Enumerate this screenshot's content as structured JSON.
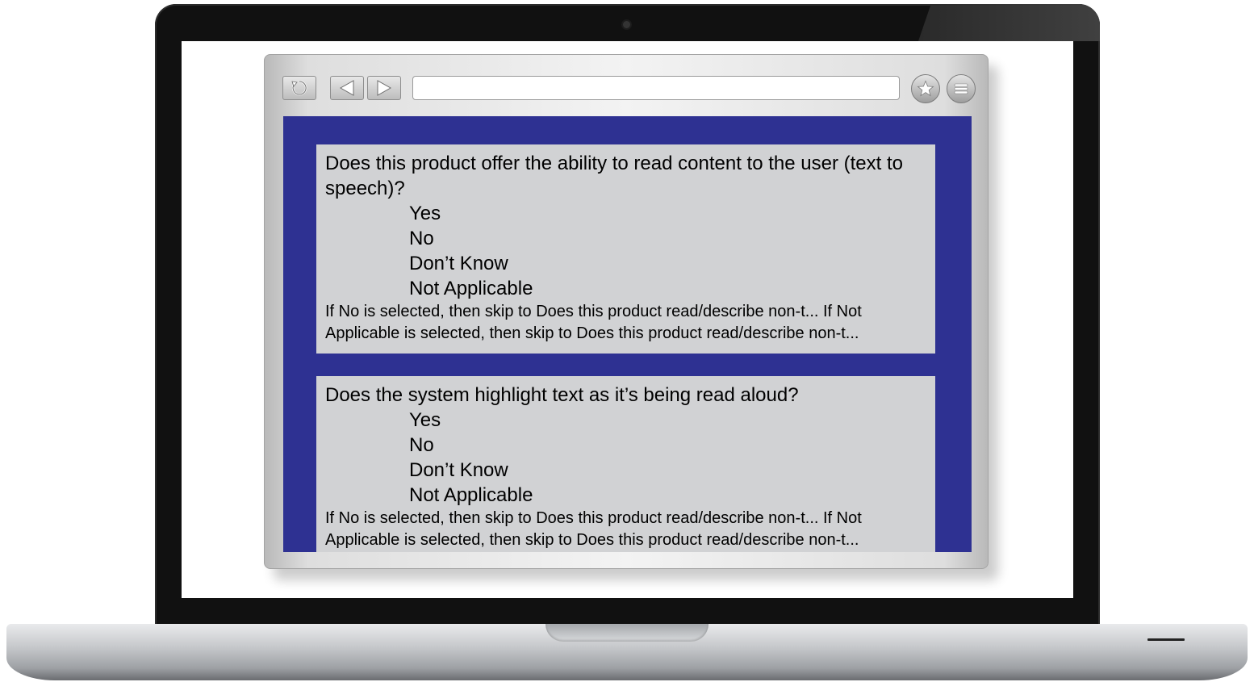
{
  "browser": {
    "url": ""
  },
  "questions": [
    {
      "text": "Does this product offer the ability to read content to the user (text to speech)?",
      "options": [
        "Yes",
        "No",
        "Don’t Know",
        "Not Applicable"
      ],
      "note": "If No is selected, then skip to Does this product read/describe non-t... If Not Applicable is selected, then skip to Does this product read/describe non-t..."
    },
    {
      "text": "Does the system highlight text as it’s being read aloud?",
      "options": [
        "Yes",
        "No",
        "Don’t Know",
        "Not Applicable"
      ],
      "note": "If No is selected, then skip to Does this product read/describe non-t... If Not Applicable is selected, then skip to Does this product read/describe non-t..."
    }
  ],
  "colors": {
    "content_background": "#2e3192",
    "card_background": "#d1d2d4",
    "bezel": "#111111"
  },
  "icons": [
    "reload-icon",
    "back-arrow-icon",
    "forward-arrow-icon",
    "star-icon",
    "menu-icon"
  ]
}
